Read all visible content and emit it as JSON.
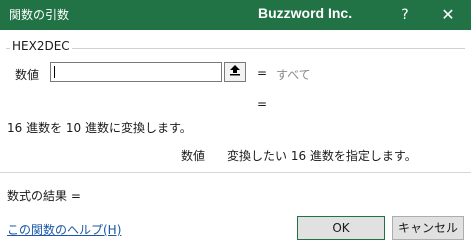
{
  "titlebar": {
    "title": "関数の引数",
    "brand": "Buzzword Inc.",
    "help_glyph": "?",
    "close_glyph": "✕",
    "background_color": "#217346"
  },
  "function_group": {
    "name": "HEX2DEC",
    "argument": {
      "label": "数値",
      "value": "",
      "collapse_icon": "collapse-dialog-icon",
      "equals": "=",
      "evaluated": "すべて"
    },
    "result_equals": "="
  },
  "description": "16 進数を 10 進数に変換します。",
  "argument_help": {
    "name": "数値",
    "text": "変換したい 16 進数を指定します。"
  },
  "formula_result": "数式の結果 =",
  "help_link": "この関数のヘルプ(H)",
  "buttons": {
    "ok": "OK",
    "cancel": "キャンセル"
  }
}
